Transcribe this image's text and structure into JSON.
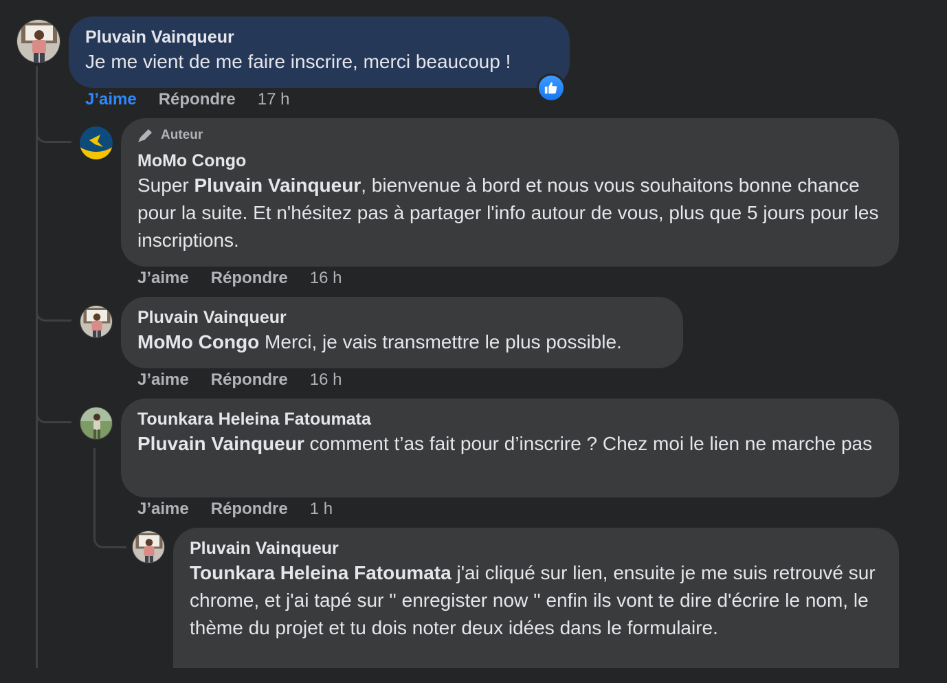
{
  "comments": [
    {
      "author": "Pluvain Vainqueur",
      "text": "Je me vient de me faire inscrire, merci beaucoup !",
      "actions": {
        "like": "J’aime",
        "reply": "Répondre",
        "time": "17 h"
      },
      "reaction": "like-icon",
      "liked": true
    },
    {
      "badge": "Auteur",
      "author": "MoMo Congo",
      "text_before": "Super ",
      "mention": "Pluvain Vainqueur",
      "text_after": ", bienvenue à bord et nous vous souhaitons bonne chance pour la suite. Et n'hésitez pas à partager l'info autour de vous, plus que 5 jours pour les inscriptions.",
      "actions": {
        "like": "J’aime",
        "reply": "Répondre",
        "time": "16 h"
      }
    },
    {
      "author": "Pluvain Vainqueur",
      "mention": "MoMo Congo",
      "text_after": " Merci, je vais transmettre le plus possible.",
      "actions": {
        "like": "J’aime",
        "reply": "Répondre",
        "time": "16 h"
      }
    },
    {
      "author": "Tounkara Heleina Fatoumata",
      "mention": "Pluvain Vainqueur",
      "text_after": " comment t’as fait pour d’inscrire ? Chez moi le lien ne marche pas",
      "actions": {
        "like": "J’aime",
        "reply": "Répondre",
        "time": "1 h"
      }
    },
    {
      "author": "Pluvain Vainqueur",
      "mention": "Tounkara Heleina Fatoumata",
      "text_after": " j'ai cliqué sur lien, ensuite je me suis retrouvé sur chrome, et j'ai tapé sur '' enregister now '' enfin ils vont te dire d'écrire le nom, le thème du projet et tu dois noter deux idées dans le formulaire."
    }
  ],
  "colors": {
    "background": "#242526",
    "bubble": "#3a3b3c",
    "highlight_bubble": "#263858",
    "like_blue": "#2d88ff",
    "muted_text": "#b0b3b8"
  }
}
